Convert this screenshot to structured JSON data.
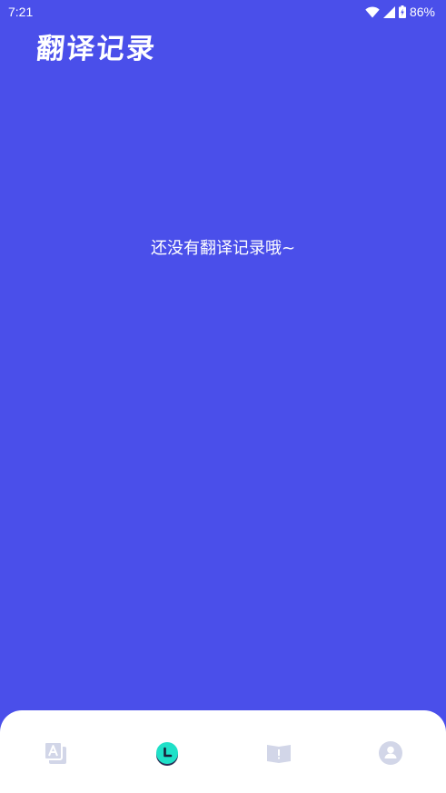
{
  "status_bar": {
    "time": "7:21",
    "battery": "86%",
    "icons": [
      "wifi-icon",
      "signal-icon",
      "battery-icon"
    ]
  },
  "header": {
    "title": "翻译记录"
  },
  "main": {
    "empty_message": "还没有翻译记录哦~"
  },
  "bottom_nav": {
    "items": [
      {
        "icon": "translate-icon",
        "active": false
      },
      {
        "icon": "clock-icon",
        "active": true
      },
      {
        "icon": "book-icon",
        "active": false
      },
      {
        "icon": "profile-icon",
        "active": false
      }
    ]
  },
  "colors": {
    "background": "#4a4fea",
    "nav_background": "#ffffff",
    "inactive_icon": "#d2d6e8",
    "active_icon": "#1fe0c8"
  }
}
